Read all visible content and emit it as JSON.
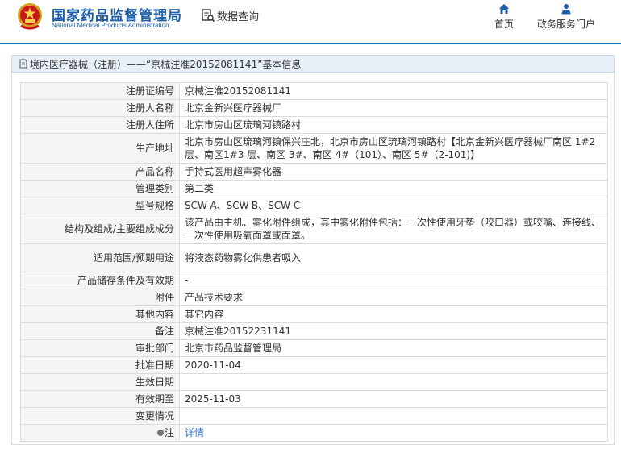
{
  "header": {
    "logo_cn": "国家药品监督管理局",
    "logo_en": "National Medical Products Administration",
    "query_label": "数据查询",
    "query_icon": "search-document-icon",
    "nav": {
      "home_label": "首页",
      "home_icon": "home-icon",
      "service_label": "政务服务门户",
      "service_icon": "user-icon"
    },
    "brand_color": "#1e5fa8"
  },
  "breadcrumb": {
    "text": "境内医疗器械（注册）——“京械注准20152081141”基本信息",
    "icon": "document-icon"
  },
  "rows": [
    {
      "key": "注册证编号",
      "value": "京械注准20152081141",
      "h": 21
    },
    {
      "key": "注册人名称",
      "value": "北京金新兴医疗器械厂",
      "h": 21
    },
    {
      "key": "注册人住所",
      "value": "北京市房山区琉璃河镇路村",
      "h": 21
    },
    {
      "key": "生产地址",
      "value": "北京市房山区琉璃河镇保兴庄北，北京市房山区琉璃河镇路村【北京金新兴医疗器械厂南区 1#2 层、南区1#3 层、南区 3#、南区 4#（101）、南区 5#（2-101)】",
      "h": 35
    },
    {
      "key": "产品名称",
      "value": "手持式医用超声雾化器",
      "h": 21
    },
    {
      "key": "管理类别",
      "value": "第二类",
      "h": 21
    },
    {
      "key": "型号规格",
      "value": "SCW-A、SCW-B、SCW-C",
      "h": 21
    },
    {
      "key": "结构及组成/主要组成成分",
      "value": "该产品由主机、雾化附件组成，其中雾化附件包括：一次性使用牙垫（咬口器）或咬嘴、连接线、一次性使用吸氧面罩或面罩。",
      "h": 35
    },
    {
      "key": "适用范围/预期用途",
      "value": "将液态药物雾化供患者吸入",
      "h": 35
    },
    {
      "key": "产品储存条件及有效期",
      "value": "-",
      "h": 21
    },
    {
      "key": "附件",
      "value": "产品技术要求",
      "h": 21
    },
    {
      "key": "其他内容",
      "value": "其它内容",
      "h": 21
    },
    {
      "key": "备注",
      "value": "京械注准20152231141",
      "h": 21
    },
    {
      "key": "审批部门",
      "value": "北京市药品监督管理局",
      "h": 21
    },
    {
      "key": "批准日期",
      "value": "2020-11-04",
      "h": 21
    },
    {
      "key": "生效日期",
      "value": "",
      "h": 21
    },
    {
      "key": "有效期至",
      "value": "2025-11-03",
      "h": 21
    },
    {
      "key": "变更情况",
      "value": "",
      "h": 21
    },
    {
      "key": "注",
      "value": "详情",
      "h": 21,
      "icon": "note-icon",
      "link": true
    }
  ]
}
